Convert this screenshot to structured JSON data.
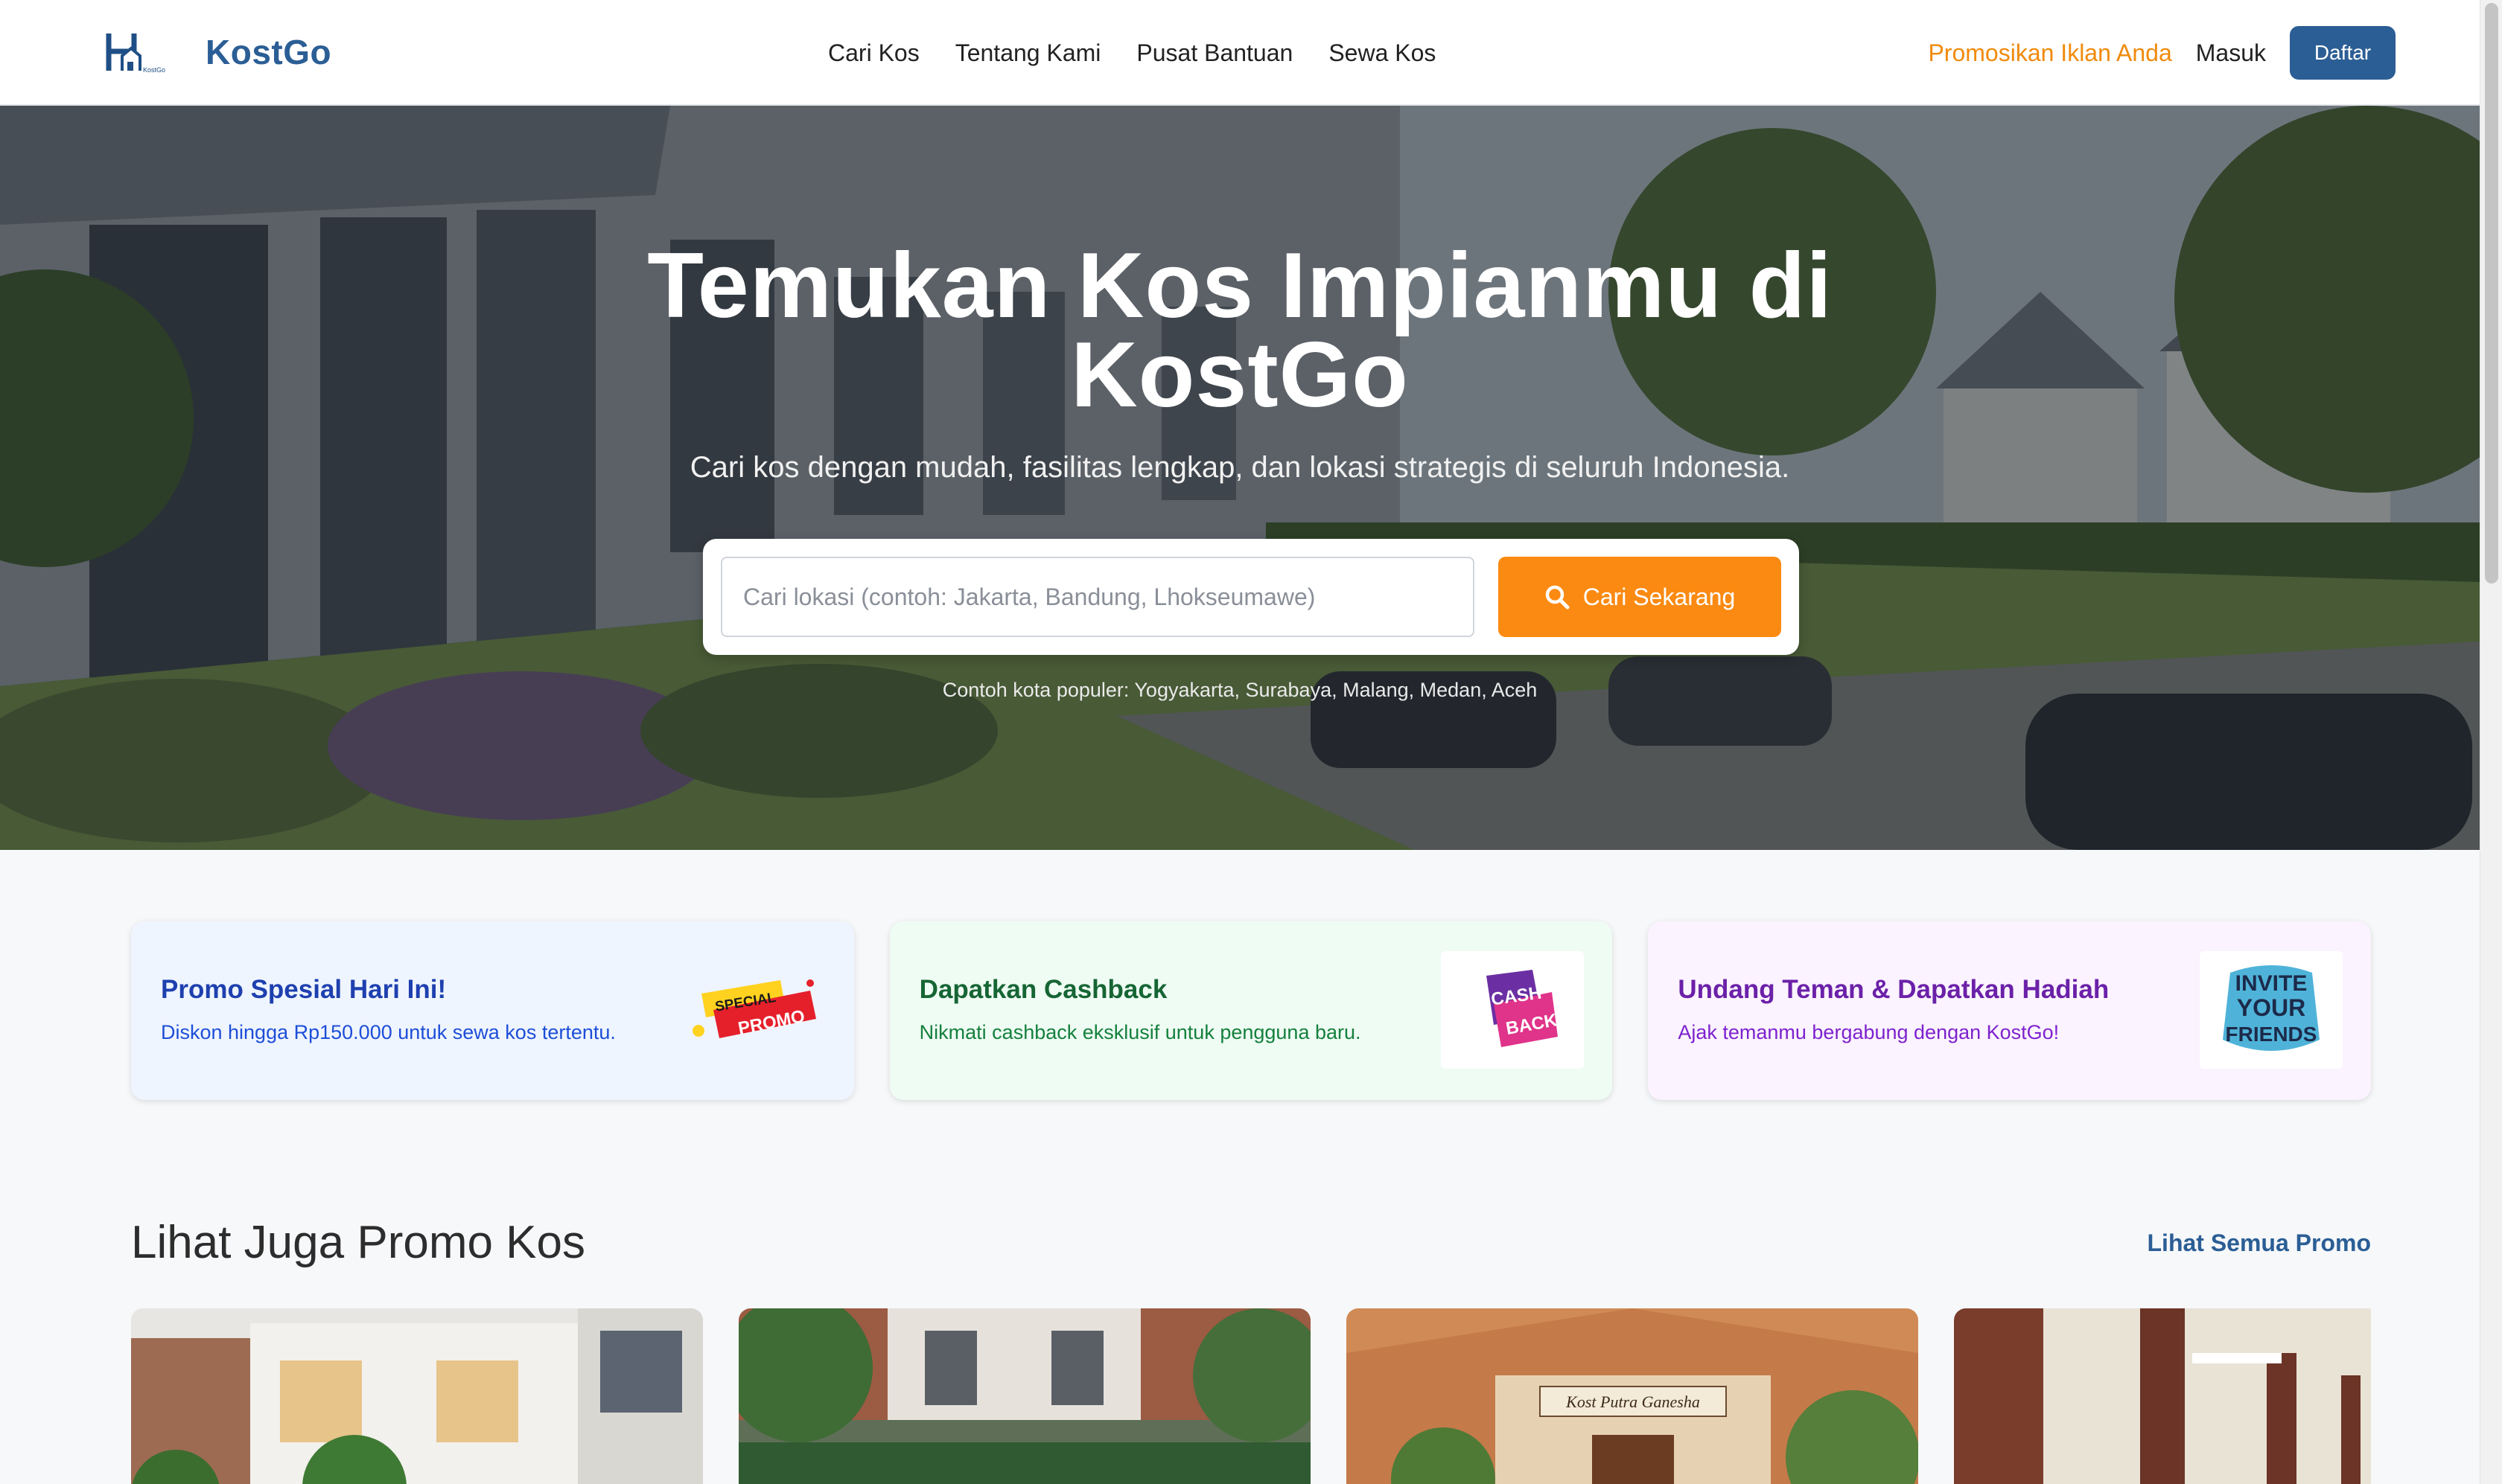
{
  "nav": {
    "brand": "KostGo",
    "logo_small_text": "KostGo",
    "links": [
      "Cari Kos",
      "Tentang Kami",
      "Pusat Bantuan",
      "Sewa Kos"
    ],
    "promote": "Promosikan Iklan Anda",
    "login": "Masuk",
    "register": "Daftar"
  },
  "hero": {
    "title_line1": "Temukan Kos Impianmu di",
    "title_line2": "KostGo",
    "subtitle": "Cari kos dengan mudah, fasilitas lengkap, dan lokasi strategis di seluruh Indonesia.",
    "search_placeholder": "Cari lokasi (contoh: Jakarta, Bandung, Lhokseumawe)",
    "search_button": "Cari Sekarang",
    "popular": "Contoh kota populer: Yogyakarta, Surabaya, Malang, Medan, Aceh"
  },
  "promos": [
    {
      "title": "Promo Spesial Hari Ini!",
      "desc": "Diskon hingga Rp150.000 untuk sewa kos tertentu.",
      "badge_top": "SPECIAL",
      "badge_bottom": "PROMO"
    },
    {
      "title": "Dapatkan Cashback",
      "desc": "Nikmati cashback eksklusif untuk pengguna baru.",
      "badge_top": "CASH",
      "badge_bottom": "BACK"
    },
    {
      "title": "Undang Teman & Dapatkan Hadiah",
      "desc": "Ajak temanmu bergabung dengan KostGo!",
      "badge_l1": "INVITE",
      "badge_l2": "YOUR",
      "badge_l3": "FRIENDS"
    }
  ],
  "section": {
    "title": "Lihat Juga Promo Kos",
    "see_all": "Lihat Semua Promo"
  },
  "kos_cards": [
    {
      "sign": ""
    },
    {
      "sign": ""
    },
    {
      "sign": "Kost Putra Ganesha"
    },
    {
      "sign": ""
    }
  ],
  "colors": {
    "brand": "#2b5e95",
    "accent": "#fb8a12",
    "promote_link": "#f08a0c"
  }
}
